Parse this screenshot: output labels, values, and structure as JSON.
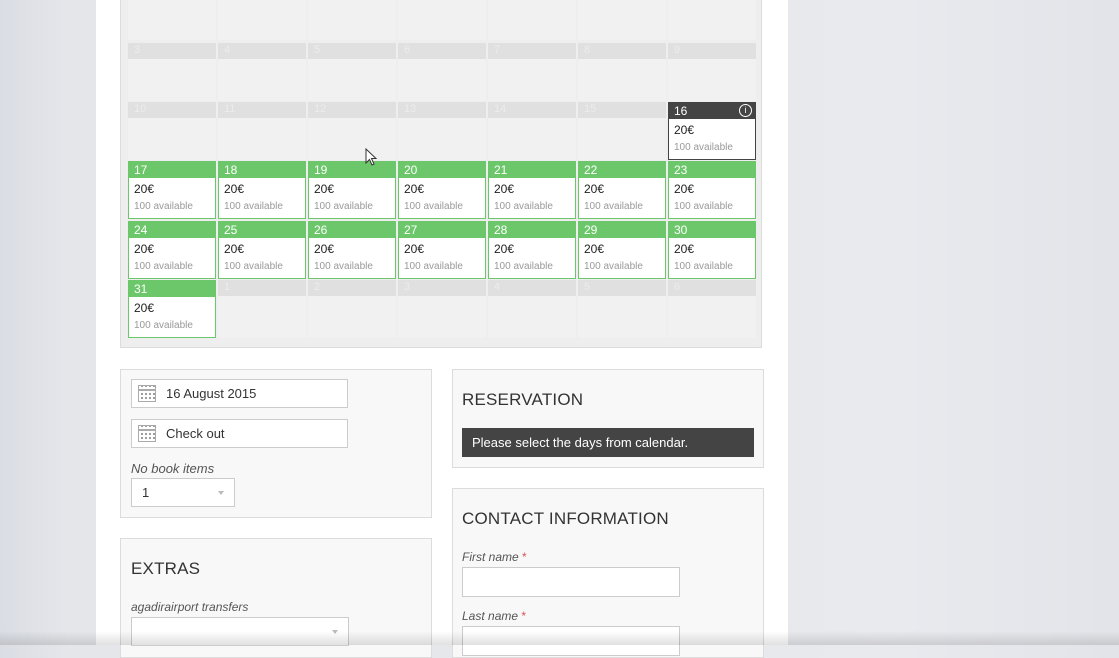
{
  "calendar": {
    "pad_top": [
      "",
      "",
      "",
      "",
      "",
      "",
      ""
    ],
    "row1_dims": [
      "3",
      "4",
      "5",
      "6",
      "7",
      "8",
      "9"
    ],
    "row2_dims": [
      "10",
      "11",
      "12",
      "13",
      "14",
      "15"
    ],
    "selected": {
      "day": "16",
      "price": "20€",
      "avail": "100 available"
    },
    "avail_days": [
      {
        "day": "17",
        "price": "20€",
        "avail": "100 available"
      },
      {
        "day": "18",
        "price": "20€",
        "avail": "100 available"
      },
      {
        "day": "19",
        "price": "20€",
        "avail": "100 available"
      },
      {
        "day": "20",
        "price": "20€",
        "avail": "100 available"
      },
      {
        "day": "21",
        "price": "20€",
        "avail": "100 available"
      },
      {
        "day": "22",
        "price": "20€",
        "avail": "100 available"
      },
      {
        "day": "23",
        "price": "20€",
        "avail": "100 available"
      },
      {
        "day": "24",
        "price": "20€",
        "avail": "100 available"
      },
      {
        "day": "25",
        "price": "20€",
        "avail": "100 available"
      },
      {
        "day": "26",
        "price": "20€",
        "avail": "100 available"
      },
      {
        "day": "27",
        "price": "20€",
        "avail": "100 available"
      },
      {
        "day": "28",
        "price": "20€",
        "avail": "100 available"
      },
      {
        "day": "29",
        "price": "20€",
        "avail": "100 available"
      },
      {
        "day": "30",
        "price": "20€",
        "avail": "100 available"
      },
      {
        "day": "31",
        "price": "20€",
        "avail": "100 available"
      }
    ],
    "next_month": [
      "1",
      "2",
      "3",
      "4",
      "5",
      "6"
    ]
  },
  "booking": {
    "check_in": "16 August 2015",
    "check_out": "Check out",
    "items_label": "No book items",
    "items_value": "1"
  },
  "extras": {
    "title": "EXTRAS",
    "transfer_label": "agadirairport transfers"
  },
  "reservation": {
    "title": "RESERVATION",
    "message": "Please select the days from calendar."
  },
  "contact": {
    "title": "CONTACT INFORMATION",
    "first_name_label": "First name",
    "last_name_label": "Last name",
    "required_mark": "*"
  }
}
